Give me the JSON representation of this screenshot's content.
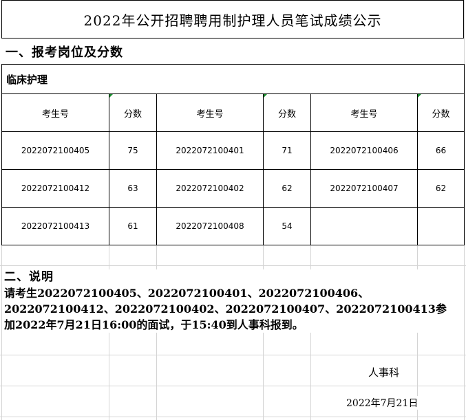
{
  "title": "2022年公开招聘聘用制护理人员笔试成绩公示",
  "section1_heading": "一、报考岗位及分数",
  "category": "临床护理",
  "table": {
    "headers": [
      "考生号",
      "分数",
      "考生号",
      "分数",
      "考生号",
      "分数"
    ],
    "rows": [
      [
        "2022072100405",
        "75",
        "2022072100401",
        "71",
        "2022072100406",
        "66"
      ],
      [
        "2022072100412",
        "63",
        "2022072100402",
        "62",
        "2022072100407",
        "62"
      ],
      [
        "2022072100413",
        "61",
        "2022072100408",
        "54",
        "",
        ""
      ]
    ]
  },
  "notes": {
    "heading": "二、说明",
    "line1": "请考生2022072100405、2022072100401、2022072100406、",
    "line2": "2022072100412、2022072100402、2022072100407、2022072100413参",
    "line3": "加2022年7月21日16:00的面试，于15:40到人事科报到。"
  },
  "signature": "人事科",
  "date": "2022年7月21日"
}
